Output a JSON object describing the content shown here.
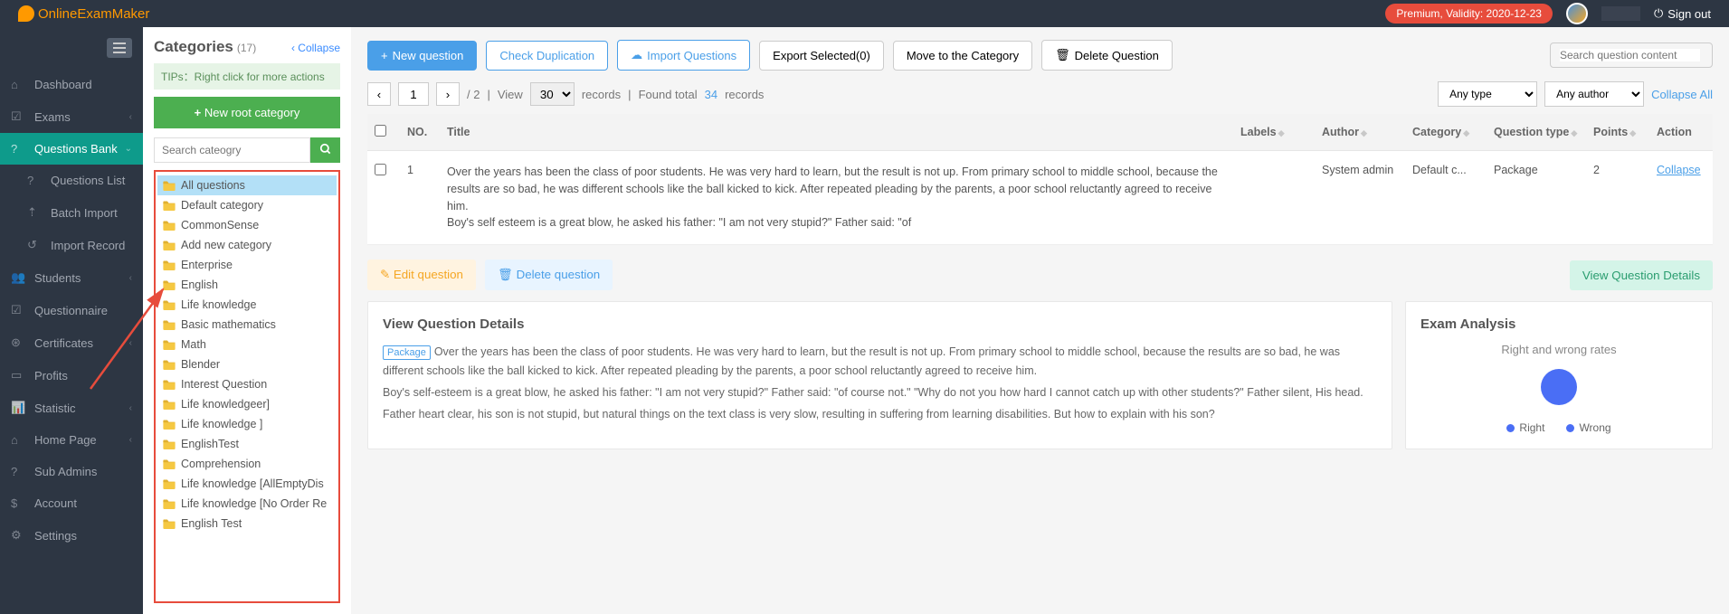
{
  "header": {
    "brand": "OnlineExamMaker",
    "premium": "Premium, Validity: 2020-12-23",
    "signout": "Sign out"
  },
  "sidebar": {
    "items": [
      {
        "label": "Dashboard",
        "icon": "home"
      },
      {
        "label": "Exams",
        "icon": "check",
        "chev": true
      },
      {
        "label": "Questions Bank",
        "icon": "help",
        "active": true,
        "chev": true
      },
      {
        "label": "Questions List",
        "icon": "help",
        "sub": true
      },
      {
        "label": "Batch Import",
        "icon": "upload",
        "sub": true
      },
      {
        "label": "Import Record",
        "icon": "history",
        "sub": true
      },
      {
        "label": "Students",
        "icon": "users",
        "chev": true
      },
      {
        "label": "Questionnaire",
        "icon": "clipboard"
      },
      {
        "label": "Certificates",
        "icon": "cert",
        "chev": true
      },
      {
        "label": "Profits",
        "icon": "card"
      },
      {
        "label": "Statistic",
        "icon": "stats",
        "chev": true
      },
      {
        "label": "Home Page",
        "icon": "home2",
        "chev": true
      },
      {
        "label": "Sub Admins",
        "icon": "admin"
      },
      {
        "label": "Account",
        "icon": "dollar"
      },
      {
        "label": "Settings",
        "icon": "gear"
      }
    ]
  },
  "categories": {
    "title": "Categories",
    "count": "(17)",
    "collapse": "Collapse",
    "tips": "TIPs：Right click for more actions",
    "new_root": "New root category",
    "search_ph": "Search cateogry",
    "items": [
      "All questions",
      "Default category",
      "CommonSense",
      "Add new category",
      "Enterprise",
      "English",
      "Life knowledge",
      "Basic mathematics",
      "Math",
      "Blender",
      "Interest Question",
      "Life knowledgeer]",
      "Life knowledge ]",
      "EnglishTest",
      "Comprehension",
      "Life knowledge [AllEmptyDis",
      "Life knowledge [No Order Re",
      "English Test"
    ]
  },
  "toolbar": {
    "new_q": "New question",
    "check_dup": "Check Duplication",
    "import": "Import Questions",
    "export": "Export Selected(0)",
    "move": "Move to the Category",
    "delete": "Delete Question",
    "search_ph": "Search question content"
  },
  "pager": {
    "page": "1",
    "total_pages": "/ 2",
    "view": "View",
    "per": "30",
    "records": "records",
    "found_pre": "Found total",
    "found_n": "34",
    "found_post": "records",
    "type": "Any type",
    "author": "Any author",
    "collapse_all": "Collapse All"
  },
  "table": {
    "headers": {
      "no": "NO.",
      "title": "Title",
      "labels": "Labels",
      "author": "Author",
      "category": "Category",
      "qtype": "Question type",
      "points": "Points",
      "action": "Action"
    },
    "rows": [
      {
        "no": "1",
        "title": "Over the years has been the class of poor students. He was very hard to learn, but the result is not up. From primary school to middle school, because the results are so bad, he was different schools like the ball kicked to kick. After repeated pleading by the parents, a poor school reluctantly agreed to receive him.\nBoy's self esteem is a great blow, he asked his father: \"I am not very stupid?\" Father said: \"of",
        "author": "System admin",
        "category": "Default c...",
        "qtype": "Package",
        "points": "2",
        "action": "Collapse"
      }
    ]
  },
  "actions": {
    "edit": "Edit question",
    "delete": "Delete question",
    "view": "View Question Details"
  },
  "detail": {
    "title": "View Question Details",
    "tag": "Package",
    "p1": "Over the years has been the class of poor students. He was very hard to learn, but the result is not up. From primary school to middle school, because the results are so bad, he was different schools like the ball kicked to kick. After repeated pleading by the parents, a poor school reluctantly agreed to receive him.",
    "p2": "Boy's self-esteem is a great blow, he asked his father: \"I am not very stupid?\" Father said: \"of course not.\" \"Why do not you how hard I cannot catch up with other students?\" Father silent, His head.",
    "p3": "Father heart clear, his son is not stupid, but natural things on the text class is very slow, resulting in suffering from learning disabilities. But how to explain with his son?"
  },
  "analysis": {
    "title": "Exam Analysis",
    "chart_title": "Right and wrong rates",
    "legend": {
      "right": "Right",
      "wrong": "Wrong"
    }
  },
  "chart_data": {
    "type": "pie",
    "title": "Right and wrong rates",
    "series": [
      {
        "name": "Right",
        "value": 100,
        "color": "#4a6ef5"
      },
      {
        "name": "Wrong",
        "value": 0,
        "color": "#4a6ef5"
      }
    ]
  }
}
